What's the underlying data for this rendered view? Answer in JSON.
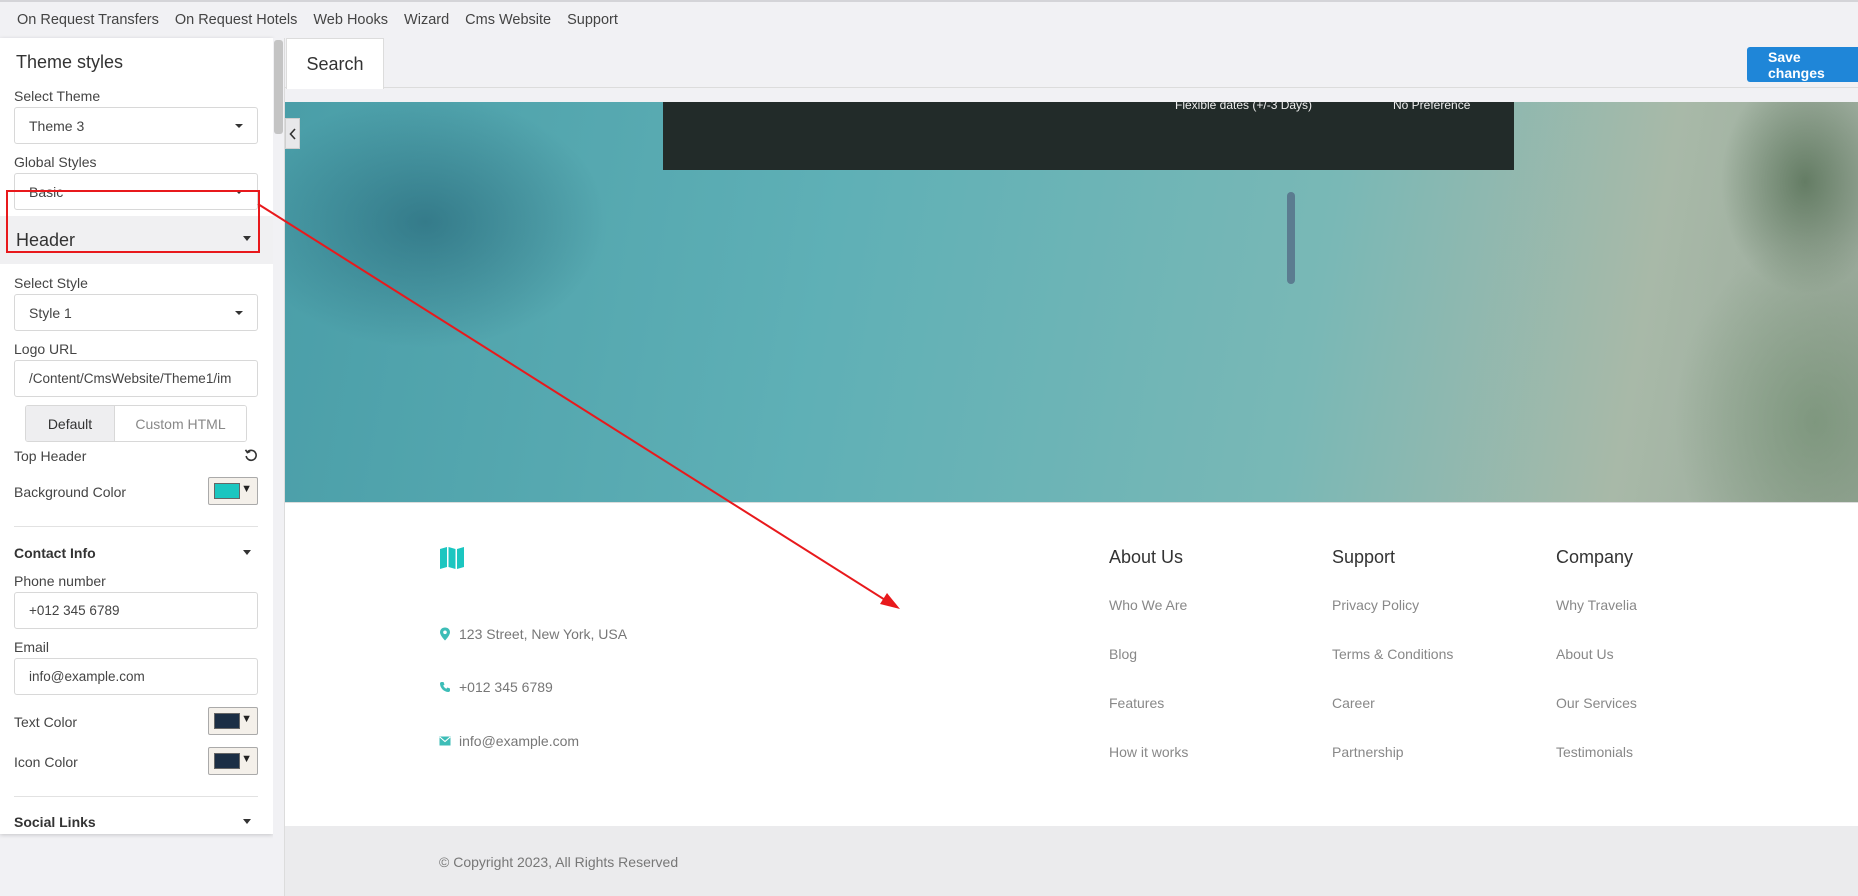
{
  "topnav": [
    "On Request Transfers",
    "On Request Hotels",
    "Web Hooks",
    "Wizard",
    "Cms Website",
    "Support"
  ],
  "panel": {
    "title": "Theme styles",
    "select_theme_label": "Select Theme",
    "select_theme_value": "Theme 3",
    "global_styles_label": "Global Styles",
    "global_styles_value": "Basic",
    "header_section": "Header",
    "select_style_label": "Select Style",
    "select_style_value": "Style 1",
    "logo_url_label": "Logo URL",
    "logo_url_value": "/Content/CmsWebsite/Theme1/im",
    "segment_default": "Default",
    "segment_custom": "Custom HTML",
    "top_header_label": "Top Header",
    "background_color_label": "Background Color",
    "background_color": "#1bc6c0",
    "contact_info_label": "Contact Info",
    "phone_label": "Phone number",
    "phone_value": "+012 345 6789",
    "email_label": "Email",
    "email_value": "info@example.com",
    "text_color_label": "Text Color",
    "text_color": "#1b2e45",
    "icon_color_label": "Icon Color",
    "icon_color": "#1b2e45",
    "social_links_label": "Social Links"
  },
  "tabs": {
    "search": "Search"
  },
  "toolbar": {
    "save_label": "Save changes"
  },
  "hero": {
    "flexible_dates": "Flexible dates (+/-3 Days)",
    "preference": "No Preference"
  },
  "footer": {
    "address": "123 Street, New York, USA",
    "phone": "+012 345 6789",
    "email": "info@example.com",
    "columns": [
      {
        "title": "About Us",
        "links": [
          "Who We Are",
          "Blog",
          "Features",
          "How it works"
        ]
      },
      {
        "title": "Support",
        "links": [
          "Privacy Policy",
          "Terms & Conditions",
          "Career",
          "Partnership"
        ]
      },
      {
        "title": "Company",
        "links": [
          "Why Travelia",
          "About Us",
          "Our Services",
          "Testimonials"
        ]
      }
    ],
    "copyright": "© Copyright 2023, All Rights Reserved"
  },
  "colors": {
    "accent": "#1f86d8",
    "teal": "#3dbdb7",
    "annotation": "#e8191c"
  }
}
